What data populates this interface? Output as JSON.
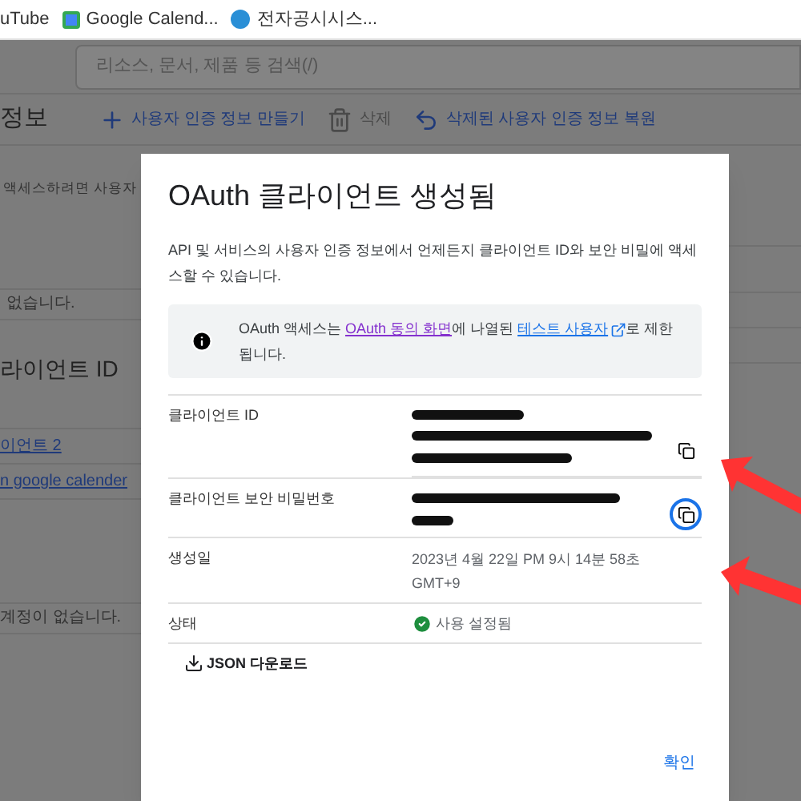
{
  "bookmarks": [
    {
      "label": "uTube"
    },
    {
      "label": "Google Calend..."
    },
    {
      "label": "전자공시시스..."
    }
  ],
  "search": {
    "placeholder": "리소스, 문서, 제품 등 검색(/)"
  },
  "page_title": "정보",
  "toolbar": [
    {
      "label": "사용자 인증 정보 만들기",
      "kind": "create",
      "disabled": false
    },
    {
      "label": "삭제",
      "kind": "delete",
      "disabled": true
    },
    {
      "label": "삭제된 사용자 인증 정보 복원",
      "kind": "restore",
      "disabled": false
    }
  ],
  "background": {
    "notice": "액세스하려면 사용자",
    "empty_1": "없습니다.",
    "section_title": "라이언트 ID",
    "links": [
      "이언트 2",
      "n google calender"
    ],
    "empty_2": "계정이 없습니다."
  },
  "dialog": {
    "title": "OAuth 클라이언트 생성됨",
    "description": "API 및 서비스의 사용자 인증 정보에서 언제든지 클라이언트 ID와 보안 비밀에 액세스할 수 있습니다.",
    "info": {
      "before": "OAuth 액세스는 ",
      "link_1": "OAuth 동의 화면",
      "middle": "에 나열된 ",
      "link_2": "테스트 사용자",
      "after": "로 제한됩니다."
    },
    "fields": [
      {
        "label": "클라이언트 ID",
        "kind": "redacted",
        "copy_focused": false
      },
      {
        "label": "클라이언트 보안 비밀번호",
        "kind": "redacted",
        "copy_focused": true
      },
      {
        "label": "생성일",
        "kind": "text",
        "value": "2023년 4월 22일 PM 9시 14분 58초 GMT+9"
      },
      {
        "label": "상태",
        "kind": "status",
        "value": "사용 설정됨",
        "enabled": true
      }
    ],
    "download": "JSON 다운로드",
    "confirm": "확인"
  }
}
